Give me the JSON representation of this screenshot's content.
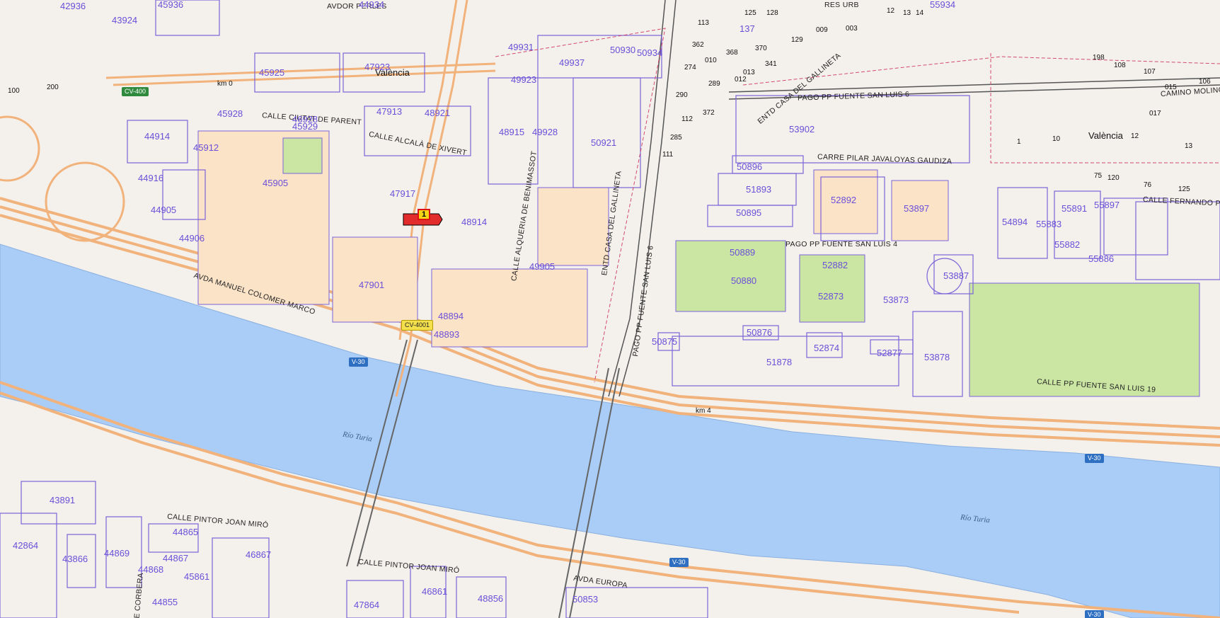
{
  "map": {
    "city_labels": [
      "València",
      "València"
    ],
    "river_labels": [
      "Río Turia",
      "Río Turia"
    ],
    "road_badges": [
      "CV-400",
      "CV-4001",
      "V-30",
      "V-30",
      "V-30",
      "V-30"
    ],
    "km_labels": [
      "km 0",
      "km 4"
    ],
    "marker_label": "1",
    "streets": [
      "CALLE ALCALÀ DE XIVERT",
      "CALLE ALQUERIA DE BENIMASSOT",
      "ENTD CASA DEL GALLINETA",
      "PAGO PP FUENTE SAN LUIS 6",
      "PAGO PP FUENTE SAN LUIS 6",
      "CARRE PILAR JAVALOYAS GAUDIZA",
      "PAGO PP FUENTE SAN LUIS 4",
      "CALLE FERNANDO PU",
      "AVDA MANUEL COLOMER MARCO",
      "CALLE PP FUENTE SAN LUIS 19",
      "CALLE PINTOR JOAN MIRÓ",
      "CALLE PINTOR JOAN MIRÓ",
      "AVDA EUROPA",
      "CALLE CIUTAT DE PARENT",
      "AVDOR PERLES",
      "DE CORBERA",
      "ENTD CASA DEL GALLINETA",
      "RES URB",
      "CAMINO MOLINO"
    ],
    "parcels": [
      "42936",
      "43924",
      "45936",
      "44934",
      "47923",
      "45925",
      "49931",
      "49937",
      "50930",
      "50934",
      "49923",
      "47913",
      "48921",
      "45928",
      "46928",
      "45929",
      "44914",
      "45912",
      "48915",
      "49928",
      "50921",
      "53902",
      "45905",
      "47917",
      "44916",
      "44905",
      "44906",
      "48914",
      "49905",
      "47901",
      "48894",
      "48893",
      "53887",
      "50896",
      "51893",
      "52892",
      "53897",
      "50895",
      "50889",
      "50880",
      "52882",
      "52873",
      "53873",
      "50875",
      "50876",
      "51878",
      "52874",
      "52877",
      "53878",
      "54894",
      "55883",
      "55891",
      "55897",
      "55882",
      "55886",
      "55934",
      "43891",
      "42864",
      "43866",
      "44869",
      "44865",
      "44867",
      "44868",
      "45861",
      "44855",
      "46867",
      "46861",
      "47864",
      "48856",
      "50853"
    ],
    "small_numbers": [
      "125",
      "128",
      "12",
      "13",
      "14",
      "113",
      "137",
      "129",
      "009",
      "003",
      "362",
      "010",
      "368",
      "370",
      "341",
      "274",
      "289",
      "013",
      "012",
      "290",
      "372",
      "112",
      "285",
      "111",
      "198",
      "108",
      "107",
      "106",
      "015",
      "017",
      "1",
      "10",
      "12",
      "13",
      "75",
      "120",
      "76",
      "125",
      "100",
      "200"
    ]
  }
}
